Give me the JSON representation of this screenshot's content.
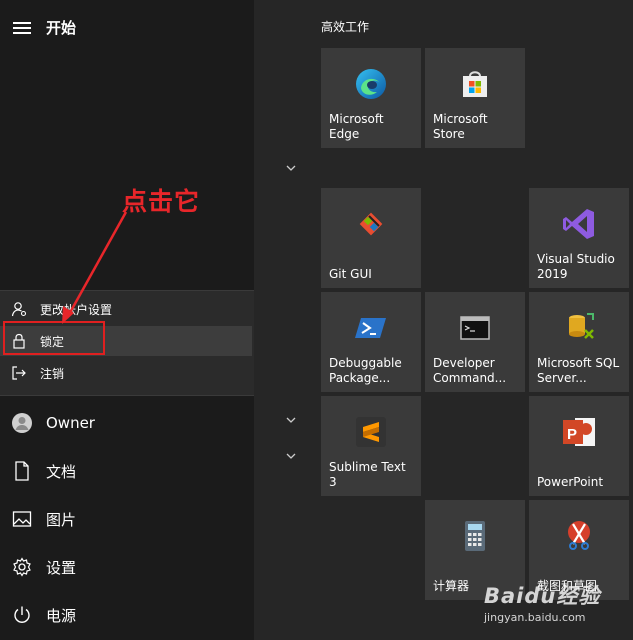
{
  "header": {
    "title": "开始"
  },
  "user_menu": [
    {
      "label": "更改帐户设置",
      "icon": "account-settings-icon"
    },
    {
      "label": "锁定",
      "icon": "lock-icon"
    },
    {
      "label": "注销",
      "icon": "sign-out-icon"
    }
  ],
  "nav": [
    {
      "label": "Owner",
      "icon": "user-avatar-icon"
    },
    {
      "label": "文档",
      "icon": "document-icon"
    },
    {
      "label": "图片",
      "icon": "picture-icon"
    },
    {
      "label": "设置",
      "icon": "gear-icon"
    },
    {
      "label": "电源",
      "icon": "power-icon"
    }
  ],
  "tiles_group": {
    "title": "高效工作"
  },
  "tiles": [
    {
      "label": "Microsoft Edge",
      "icon": "edge-icon"
    },
    {
      "label": "Microsoft Store",
      "icon": "store-icon"
    },
    {
      "label": "Git GUI",
      "icon": "git-icon"
    },
    {
      "label": "Visual Studio\n2019",
      "icon": "visual-studio-icon"
    },
    {
      "label": "Debuggable\nPackage...",
      "icon": "powershell-icon"
    },
    {
      "label": "Developer\nCommand...",
      "icon": "command-prompt-icon"
    },
    {
      "label": "Microsoft SQL\nServer...",
      "icon": "sql-server-icon"
    },
    {
      "label": "Sublime Text 3",
      "icon": "sublime-icon"
    },
    {
      "label": "PowerPoint",
      "icon": "powerpoint-icon"
    },
    {
      "label": "计算器",
      "icon": "calculator-icon"
    },
    {
      "label": "截图和草图",
      "icon": "snip-sketch-icon"
    }
  ],
  "annotation": {
    "text": "点击它",
    "color": "#e8262a"
  },
  "watermark": {
    "main": "Baidu经验",
    "sub": "jingyan.baidu.com"
  }
}
